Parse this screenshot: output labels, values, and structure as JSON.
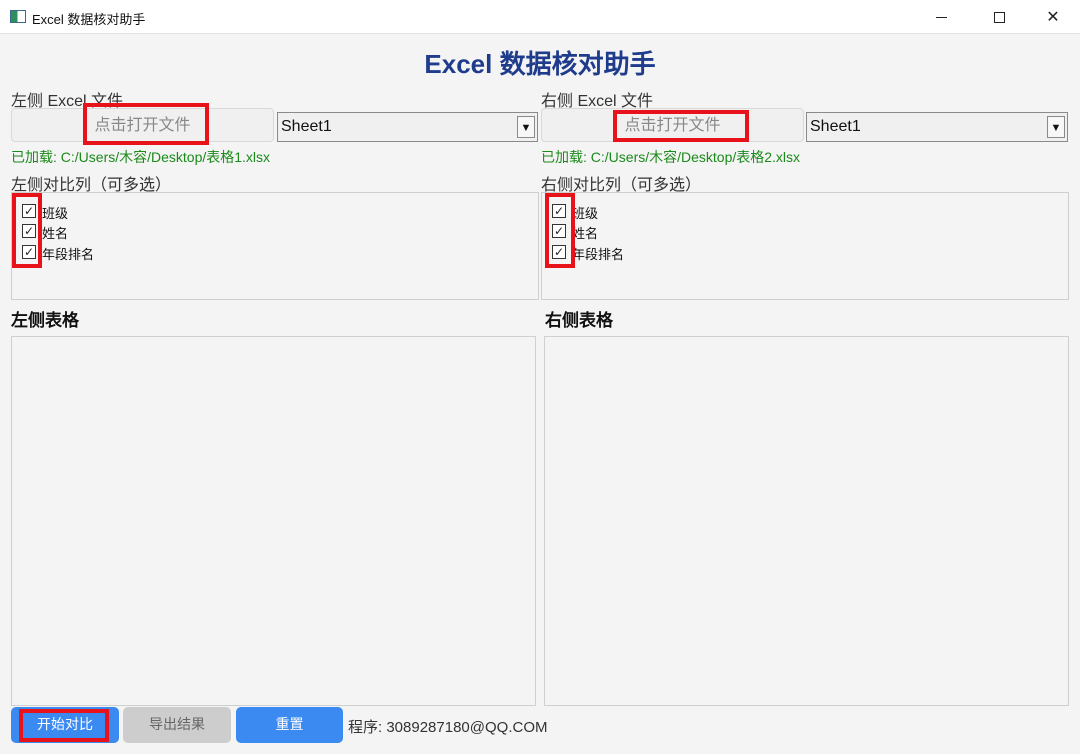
{
  "window": {
    "title": "Excel 数据核对助手",
    "minimize_icon": "minimize-icon",
    "maximize_icon": "maximize-icon",
    "close_icon": "close-icon",
    "close_glyph": "✕"
  },
  "header": {
    "title": "Excel 数据核对助手",
    "title_color": "#1f3b8c"
  },
  "left": {
    "file_label": "左侧 Excel 文件",
    "open_button": "点击打开文件",
    "sheet_select": "Sheet1",
    "loaded_text": "已加载: C:/Users/木容/Desktop/表格1.xlsx",
    "columns_label": "左侧对比列（可多选）",
    "columns": [
      {
        "label": "班级",
        "checked": true
      },
      {
        "label": "姓名",
        "checked": true
      },
      {
        "label": "年段排名",
        "checked": true
      }
    ],
    "table_label": "左侧表格"
  },
  "right": {
    "file_label": "右侧 Excel 文件",
    "open_button": "点击打开文件",
    "sheet_select": "Sheet1",
    "loaded_text": "已加载: C:/Users/木容/Desktop/表格2.xlsx",
    "columns_label": "右侧对比列（可多选）",
    "columns": [
      {
        "label": "班级",
        "checked": true
      },
      {
        "label": "姓名",
        "checked": true
      },
      {
        "label": "年段排名",
        "checked": true
      }
    ],
    "table_label": "右侧表格"
  },
  "footer": {
    "start_button": "开始对比",
    "export_button": "导出结果",
    "reset_button": "重置",
    "contact": "程序: 3089287180@QQ.COM"
  },
  "colors": {
    "accent": "#3a8af2",
    "loaded": "#1a8a1a",
    "highlight": "#e8121b"
  }
}
